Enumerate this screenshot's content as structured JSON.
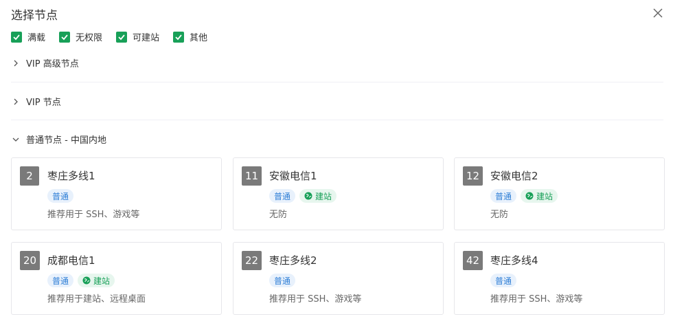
{
  "dialog": {
    "title": "选择节点",
    "close_icon": "close-icon"
  },
  "filters": [
    {
      "label": "满载",
      "checked": true
    },
    {
      "label": "无权限",
      "checked": true
    },
    {
      "label": "可建站",
      "checked": true
    },
    {
      "label": "其他",
      "checked": true
    }
  ],
  "sections": [
    {
      "label": "VIP 高级节点",
      "expanded": false
    },
    {
      "label": "VIP 节点",
      "expanded": false
    },
    {
      "label": "普通节点 - 中国内地",
      "expanded": true
    }
  ],
  "nodes": [
    {
      "num": "2",
      "name": "枣庄多线1",
      "tags": [
        "普通"
      ],
      "desc": "推荐用于 SSH、游戏等"
    },
    {
      "num": "11",
      "name": "安徽电信1",
      "tags": [
        "普通",
        "建站"
      ],
      "desc": "无防"
    },
    {
      "num": "12",
      "name": "安徽电信2",
      "tags": [
        "普通",
        "建站"
      ],
      "desc": "无防"
    },
    {
      "num": "20",
      "name": "成都电信1",
      "tags": [
        "普通",
        "建站"
      ],
      "desc": "推荐用于建站、远程桌面"
    },
    {
      "num": "22",
      "name": "枣庄多线2",
      "tags": [
        "普通"
      ],
      "desc": "推荐用于 SSH、游戏等"
    },
    {
      "num": "42",
      "name": "枣庄多线4",
      "tags": [
        "普通"
      ],
      "desc": "推荐用于 SSH、游戏等"
    }
  ],
  "colors": {
    "accent_green": "#18a058",
    "tag_blue": "#2f7fd6",
    "num_badge": "#7a7a7a"
  }
}
